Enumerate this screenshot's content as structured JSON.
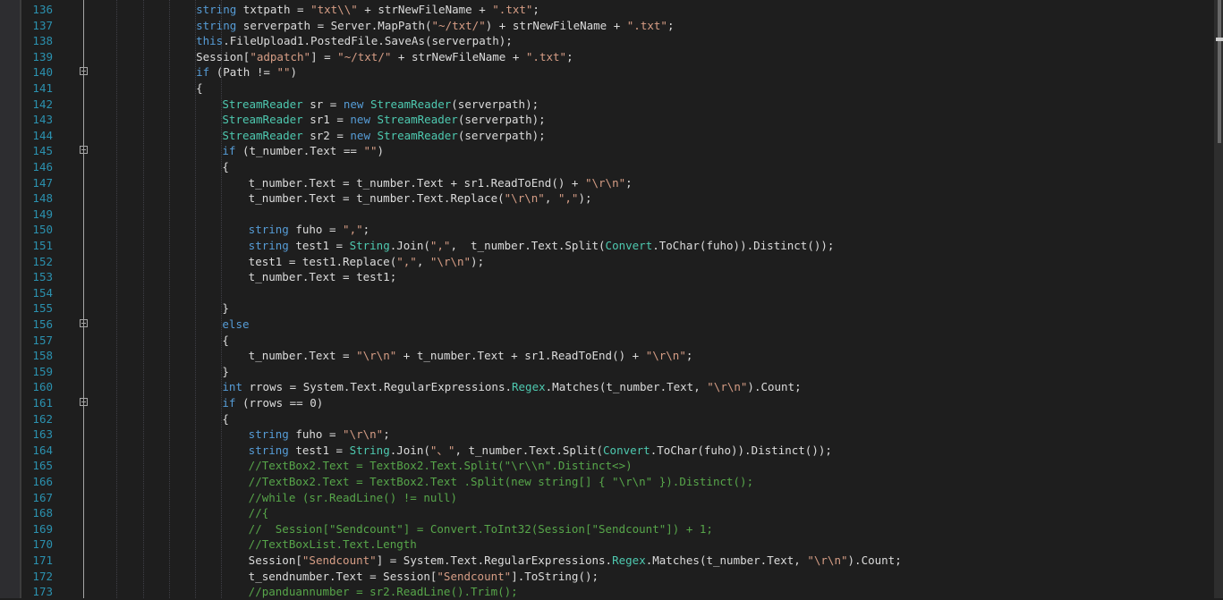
{
  "editor": {
    "lines": [
      {
        "n": "136",
        "indent": 16,
        "fold": false,
        "tokens": [
          [
            "t",
            "string"
          ],
          [
            "s",
            " txtpath = "
          ],
          [
            "c",
            "\"txt\\\\\""
          ],
          [
            "s",
            " + strNewFileName + "
          ],
          [
            "c",
            "\".txt\""
          ],
          [
            "s",
            ";"
          ]
        ]
      },
      {
        "n": "137",
        "indent": 16,
        "fold": false,
        "tokens": [
          [
            "t",
            "string"
          ],
          [
            "s",
            " serverpath = Server.MapPath("
          ],
          [
            "c",
            "\"~/txt/\""
          ],
          [
            "s",
            ") + strNewFileName + "
          ],
          [
            "c",
            "\".txt\""
          ],
          [
            "s",
            ";"
          ]
        ]
      },
      {
        "n": "138",
        "indent": 16,
        "fold": false,
        "tokens": [
          [
            "k",
            "this"
          ],
          [
            "s",
            ".FileUpload1.PostedFile.SaveAs(serverpath);"
          ]
        ]
      },
      {
        "n": "139",
        "indent": 16,
        "fold": false,
        "tokens": [
          [
            "s",
            "Session["
          ],
          [
            "c",
            "\"adpatch\""
          ],
          [
            "s",
            "] = "
          ],
          [
            "c",
            "\"~/txt/\""
          ],
          [
            "s",
            " + strNewFileName + "
          ],
          [
            "c",
            "\".txt\""
          ],
          [
            "s",
            ";"
          ]
        ]
      },
      {
        "n": "140",
        "indent": 16,
        "fold": true,
        "tokens": [
          [
            "k",
            "if"
          ],
          [
            "s",
            " (Path != "
          ],
          [
            "c",
            "\"\""
          ],
          [
            "s",
            ")"
          ]
        ]
      },
      {
        "n": "141",
        "indent": 16,
        "fold": false,
        "tokens": [
          [
            "s",
            "{"
          ]
        ]
      },
      {
        "n": "142",
        "indent": 20,
        "fold": false,
        "tokens": [
          [
            "y",
            "StreamReader"
          ],
          [
            "s",
            " sr = "
          ],
          [
            "k",
            "new"
          ],
          [
            "s",
            " "
          ],
          [
            "y",
            "StreamReader"
          ],
          [
            "s",
            "(serverpath);"
          ]
        ]
      },
      {
        "n": "143",
        "indent": 20,
        "fold": false,
        "tokens": [
          [
            "y",
            "StreamReader"
          ],
          [
            "s",
            " sr1 = "
          ],
          [
            "k",
            "new"
          ],
          [
            "s",
            " "
          ],
          [
            "y",
            "StreamReader"
          ],
          [
            "s",
            "(serverpath);"
          ]
        ]
      },
      {
        "n": "144",
        "indent": 20,
        "fold": false,
        "tokens": [
          [
            "y",
            "StreamReader"
          ],
          [
            "s",
            " sr2 = "
          ],
          [
            "k",
            "new"
          ],
          [
            "s",
            " "
          ],
          [
            "y",
            "StreamReader"
          ],
          [
            "s",
            "(serverpath);"
          ]
        ]
      },
      {
        "n": "145",
        "indent": 20,
        "fold": true,
        "tokens": [
          [
            "k",
            "if"
          ],
          [
            "s",
            " (t_number.Text == "
          ],
          [
            "c",
            "\"\""
          ],
          [
            "s",
            ")"
          ]
        ]
      },
      {
        "n": "146",
        "indent": 20,
        "fold": false,
        "tokens": [
          [
            "s",
            "{"
          ]
        ]
      },
      {
        "n": "147",
        "indent": 24,
        "fold": false,
        "tokens": [
          [
            "s",
            "t_number.Text = t_number.Text + sr1.ReadToEnd() + "
          ],
          [
            "c",
            "\"\\r\\n\""
          ],
          [
            "s",
            ";"
          ]
        ]
      },
      {
        "n": "148",
        "indent": 24,
        "fold": false,
        "tokens": [
          [
            "s",
            "t_number.Text = t_number.Text.Replace("
          ],
          [
            "c",
            "\"\\r\\n\""
          ],
          [
            "s",
            ", "
          ],
          [
            "c",
            "\",\""
          ],
          [
            "s",
            ");"
          ]
        ]
      },
      {
        "n": "149",
        "indent": 24,
        "fold": false,
        "tokens": []
      },
      {
        "n": "150",
        "indent": 24,
        "fold": false,
        "tokens": [
          [
            "t",
            "string"
          ],
          [
            "s",
            " fuho = "
          ],
          [
            "c",
            "\",\""
          ],
          [
            "s",
            ";"
          ]
        ]
      },
      {
        "n": "151",
        "indent": 24,
        "fold": false,
        "tokens": [
          [
            "t",
            "string"
          ],
          [
            "s",
            " test1 = "
          ],
          [
            "y",
            "String"
          ],
          [
            "s",
            ".Join("
          ],
          [
            "c",
            "\",\""
          ],
          [
            "s",
            ",  t_number.Text.Split("
          ],
          [
            "y",
            "Convert"
          ],
          [
            "s",
            ".ToChar(fuho)).Distinct());"
          ]
        ]
      },
      {
        "n": "152",
        "indent": 24,
        "fold": false,
        "tokens": [
          [
            "s",
            "test1 = test1.Replace("
          ],
          [
            "c",
            "\",\""
          ],
          [
            "s",
            ", "
          ],
          [
            "c",
            "\"\\r\\n\""
          ],
          [
            "s",
            ");"
          ]
        ]
      },
      {
        "n": "153",
        "indent": 24,
        "fold": false,
        "tokens": [
          [
            "s",
            "t_number.Text = test1;"
          ]
        ]
      },
      {
        "n": "154",
        "indent": 24,
        "fold": false,
        "tokens": []
      },
      {
        "n": "155",
        "indent": 20,
        "fold": false,
        "tokens": [
          [
            "s",
            "}"
          ]
        ]
      },
      {
        "n": "156",
        "indent": 20,
        "fold": true,
        "tokens": [
          [
            "k",
            "else"
          ]
        ]
      },
      {
        "n": "157",
        "indent": 20,
        "fold": false,
        "tokens": [
          [
            "s",
            "{"
          ]
        ]
      },
      {
        "n": "158",
        "indent": 24,
        "fold": false,
        "tokens": [
          [
            "s",
            "t_number.Text = "
          ],
          [
            "c",
            "\"\\r\\n\""
          ],
          [
            "s",
            " + t_number.Text + sr1.ReadToEnd() + "
          ],
          [
            "c",
            "\"\\r\\n\""
          ],
          [
            "s",
            ";"
          ]
        ]
      },
      {
        "n": "159",
        "indent": 20,
        "fold": false,
        "tokens": [
          [
            "s",
            "}"
          ]
        ]
      },
      {
        "n": "160",
        "indent": 20,
        "fold": false,
        "tokens": [
          [
            "k",
            "int"
          ],
          [
            "s",
            " rrows = System.Text.RegularExpressions."
          ],
          [
            "y",
            "Regex"
          ],
          [
            "s",
            ".Matches(t_number.Text, "
          ],
          [
            "c",
            "\"\\r\\n\""
          ],
          [
            "s",
            ").Count;"
          ]
        ]
      },
      {
        "n": "161",
        "indent": 20,
        "fold": true,
        "tokens": [
          [
            "k",
            "if"
          ],
          [
            "s",
            " (rrows == 0)"
          ]
        ]
      },
      {
        "n": "162",
        "indent": 20,
        "fold": false,
        "tokens": [
          [
            "s",
            "{"
          ]
        ]
      },
      {
        "n": "163",
        "indent": 24,
        "fold": false,
        "tokens": [
          [
            "t",
            "string"
          ],
          [
            "s",
            " fuho = "
          ],
          [
            "c",
            "\"\\r\\n\""
          ],
          [
            "s",
            ";"
          ]
        ]
      },
      {
        "n": "164",
        "indent": 24,
        "fold": false,
        "tokens": [
          [
            "t",
            "string"
          ],
          [
            "s",
            " test1 = "
          ],
          [
            "y",
            "String"
          ],
          [
            "s",
            ".Join("
          ],
          [
            "c",
            "\"、\""
          ],
          [
            "s",
            ", t_number.Text.Split("
          ],
          [
            "y",
            "Convert"
          ],
          [
            "s",
            ".ToChar(fuho)).Distinct());"
          ]
        ]
      },
      {
        "n": "165",
        "indent": 24,
        "fold": false,
        "tokens": [
          [
            "m",
            "//TextBox2.Text = TextBox2.Text.Split(\"\\r\\\\n\".Distinct<>)"
          ]
        ]
      },
      {
        "n": "166",
        "indent": 24,
        "fold": false,
        "tokens": [
          [
            "m",
            "//TextBox2.Text = TextBox2.Text .Split(new string[] { \"\\r\\n\" }).Distinct();"
          ]
        ]
      },
      {
        "n": "167",
        "indent": 24,
        "fold": false,
        "tokens": [
          [
            "m",
            "//while (sr.ReadLine() != null)"
          ]
        ]
      },
      {
        "n": "168",
        "indent": 24,
        "fold": false,
        "tokens": [
          [
            "m",
            "//{"
          ]
        ]
      },
      {
        "n": "169",
        "indent": 24,
        "fold": false,
        "tokens": [
          [
            "m",
            "//  Session[\"Sendcount\"] = Convert.ToInt32(Session[\"Sendcount\"]) + 1;"
          ]
        ]
      },
      {
        "n": "170",
        "indent": 24,
        "fold": false,
        "tokens": [
          [
            "m",
            "//TextBoxList.Text.Length"
          ]
        ]
      },
      {
        "n": "171",
        "indent": 24,
        "fold": false,
        "tokens": [
          [
            "s",
            "Session["
          ],
          [
            "c",
            "\"Sendcount\""
          ],
          [
            "s",
            "] = System.Text.RegularExpressions."
          ],
          [
            "y",
            "Regex"
          ],
          [
            "s",
            ".Matches(t_number.Text, "
          ],
          [
            "c",
            "\"\\r\\n\""
          ],
          [
            "s",
            ").Count;"
          ]
        ]
      },
      {
        "n": "172",
        "indent": 24,
        "fold": false,
        "tokens": [
          [
            "s",
            "t_sendnumber.Text = Session["
          ],
          [
            "c",
            "\"Sendcount\""
          ],
          [
            "s",
            "].ToString();"
          ]
        ]
      },
      {
        "n": "173",
        "indent": 24,
        "fold": false,
        "tokens": [
          [
            "m",
            "//panduannumber = sr2.ReadLine().Trim();"
          ]
        ]
      }
    ]
  }
}
